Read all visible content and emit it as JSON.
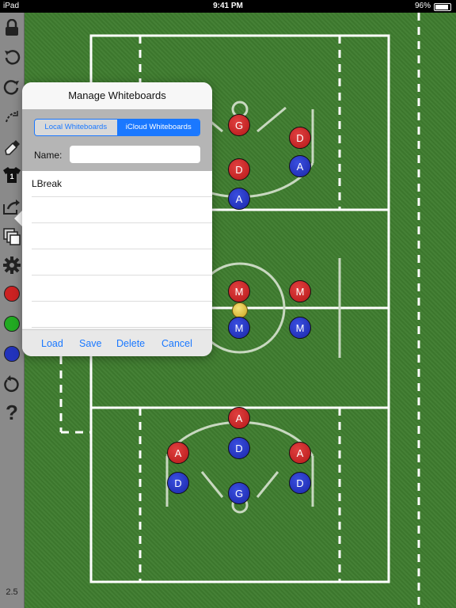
{
  "status_bar": {
    "device": "iPad",
    "time": "9:41 PM",
    "battery": "96%"
  },
  "toolbar": {
    "icons": [
      "lock-icon",
      "undo-icon",
      "redo-icon",
      "lasso-icon",
      "eraser-icon",
      "jersey-icon",
      "share-icon",
      "whiteboards-icon",
      "gear-icon",
      "red-player-tool",
      "green-player-tool",
      "blue-player-tool",
      "rotate-icon",
      "help-icon"
    ],
    "colors": {
      "red": "#cc2222",
      "green": "#22aa22",
      "blue": "#2233bb"
    },
    "jersey_number": "1",
    "help_symbol": "?",
    "version": "2.5"
  },
  "field": {
    "players": [
      {
        "label": "G",
        "team": "red"
      },
      {
        "label": "D",
        "team": "red"
      },
      {
        "label": "D",
        "team": "red"
      },
      {
        "label": "A",
        "team": "blue"
      },
      {
        "label": "A",
        "team": "blue"
      },
      {
        "label": "M",
        "team": "red"
      },
      {
        "label": "M",
        "team": "red"
      },
      {
        "label": "M",
        "team": "blue"
      },
      {
        "label": "M",
        "team": "blue"
      },
      {
        "label": "A",
        "team": "red"
      },
      {
        "label": "D",
        "team": "blue"
      },
      {
        "label": "A",
        "team": "red"
      },
      {
        "label": "A",
        "team": "red"
      },
      {
        "label": "D",
        "team": "blue"
      },
      {
        "label": "D",
        "team": "blue"
      },
      {
        "label": "G",
        "team": "blue"
      }
    ]
  },
  "dialog": {
    "title": "Manage Whiteboards",
    "segments": {
      "local": "Local Whiteboards",
      "icloud": "iCloud Whiteboards"
    },
    "name_label": "Name:",
    "name_value": "",
    "name_placeholder": "",
    "items": [
      "LBreak",
      "",
      "",
      "",
      "",
      ""
    ],
    "buttons": {
      "load": "Load",
      "save": "Save",
      "delete": "Delete",
      "cancel": "Cancel"
    }
  }
}
